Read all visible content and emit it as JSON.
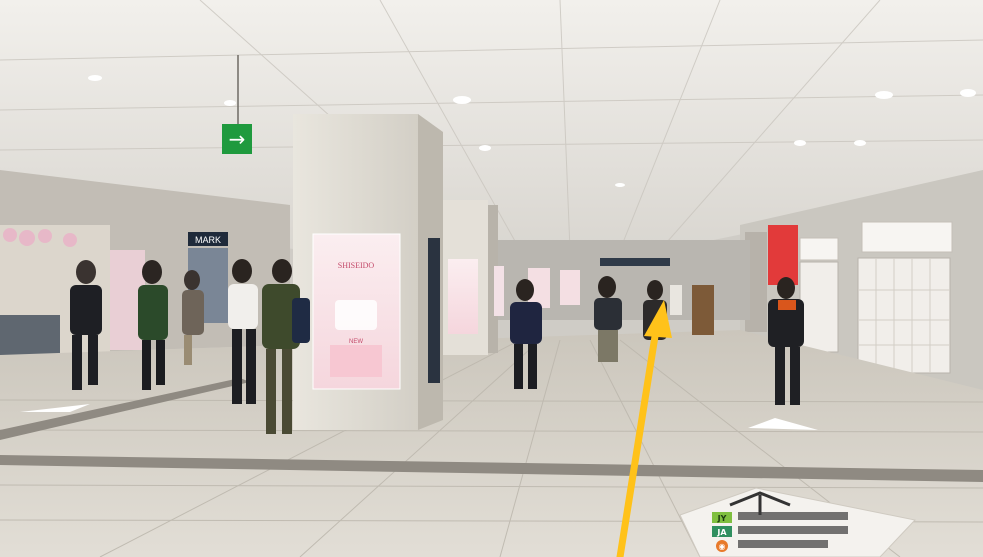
{
  "scene": {
    "exit_sign_glyph": "→",
    "left_shop_sign": "MARK",
    "ad_brand_top": "SHISEIDO",
    "ad_brand_bottom": "NEW",
    "floor_badges": [
      {
        "code": "JY",
        "color": "#7fbf3f"
      },
      {
        "code": "JA",
        "color": "#2f8f5f"
      },
      {
        "code": "◉",
        "color": "#e87a2a"
      }
    ],
    "arrow_color": "#ffc21a",
    "colors": {
      "ceiling": "#eceae6",
      "floor": "#d9d5cd",
      "wall_right": "#c9c6bf",
      "pillar": "#e7e4dc",
      "exit_sign": "#1f9a3e"
    },
    "icons": [
      "exit-arrow-icon",
      "direction-arrow-icon"
    ]
  }
}
